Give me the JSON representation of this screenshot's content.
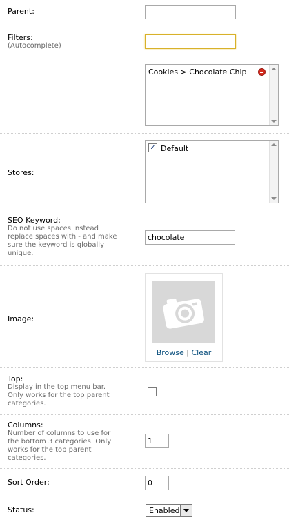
{
  "parent": {
    "label": "Parent:",
    "value": ""
  },
  "filters": {
    "label": "Filters:",
    "help": "(Autocomplete)",
    "input_value": "",
    "selected": [
      "Cookies > Chocolate Chip"
    ]
  },
  "stores": {
    "label": "Stores:",
    "options": [
      {
        "label": "Default",
        "checked": true
      }
    ]
  },
  "seo": {
    "label": "SEO Keyword:",
    "help_lines": [
      "Do not use spaces instead",
      "replace spaces with - and make",
      "sure the keyword is globally",
      "unique."
    ],
    "value": "chocolate"
  },
  "image": {
    "label": "Image:",
    "browse": "Browse",
    "separator": "|",
    "clear": "Clear"
  },
  "top": {
    "label": "Top:",
    "help_lines": [
      "Display in the top menu bar.",
      "Only works for the top parent",
      "categories."
    ],
    "checked": false
  },
  "columns": {
    "label": "Columns:",
    "help_lines": [
      "Number of columns to use for",
      "the bottom 3 categories. Only",
      "works for the top parent",
      "categories."
    ],
    "value": "1"
  },
  "sort_order": {
    "label": "Sort Order:",
    "value": "0"
  },
  "status": {
    "label": "Status:",
    "value": "Enabled"
  }
}
